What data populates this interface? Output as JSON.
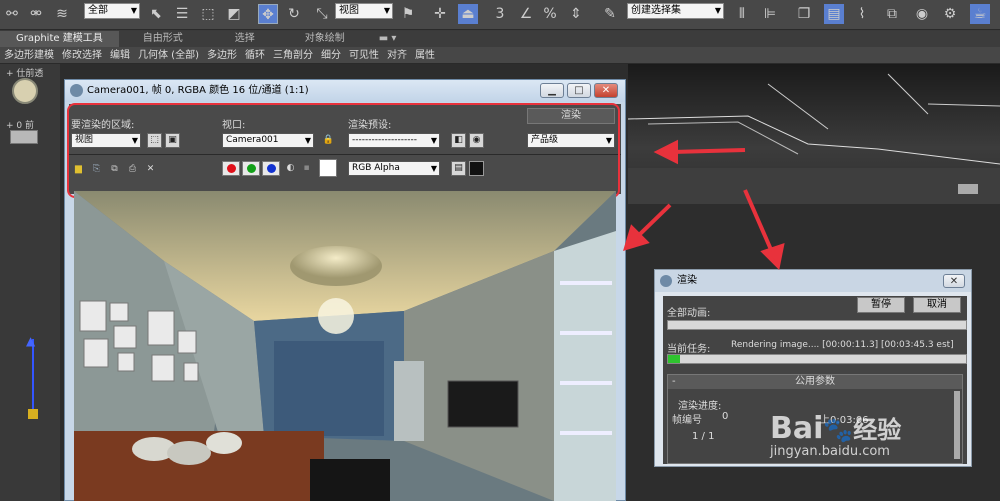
{
  "toolbar": {
    "selection_filter": "全部",
    "viewport_dropdown": "视图",
    "snap_label": "3",
    "percent_label": "%",
    "named_selection": "创建选择集"
  },
  "ribbon_tabs": [
    {
      "label": "Graphite 建模工具",
      "active": true
    },
    {
      "label": "自由形式",
      "active": false
    },
    {
      "label": "选择",
      "active": false
    },
    {
      "label": "对象绘制",
      "active": false
    }
  ],
  "ribbon_items": [
    "多边形建模",
    "修改选择",
    "编辑",
    "几何体 (全部)",
    "多边形",
    "循环",
    "三角剖分",
    "细分",
    "可见性",
    "对齐",
    "属性"
  ],
  "viewport": {
    "label_top": "+ 仕前透",
    "label_front": "+ 0 前"
  },
  "frame_window": {
    "title": "Camera001, 帧 0, RGBA 颜色 16 位/通道 (1:1)",
    "area_label": "要渲染的区域:",
    "area_value": "视图",
    "viewport_label": "视口:",
    "viewport_value": "Camera001",
    "preset_label": "渲染预设:",
    "preset_value": "--------------------",
    "render_button": "渲染",
    "quality_value": "产品级",
    "channel_value": "RGB Alpha"
  },
  "render_dialog": {
    "title": "渲染",
    "total_label": "全部动画:",
    "pause_button": "暂停",
    "cancel_button": "取消",
    "current_label": "当前任务:",
    "current_text": "Rendering image.... [00:00:11.3] [00:03:45.3 est]",
    "progress": 0.04,
    "section_title": "公用参数",
    "progress_label": "渲染进度:",
    "frame_label": "帧编号",
    "frame_value": "0",
    "page_value": "1 / 1",
    "time_value": "上0:03:06"
  },
  "watermark": {
    "brand": "Bai",
    "brand2": "经验",
    "url": "jingyan.baidu.com"
  },
  "colors": {
    "highlight": "#e8323c",
    "red_dot": "#e0101a",
    "green_dot": "#12a018",
    "blue_dot": "#1232d0",
    "progress": "#2fc42f"
  }
}
